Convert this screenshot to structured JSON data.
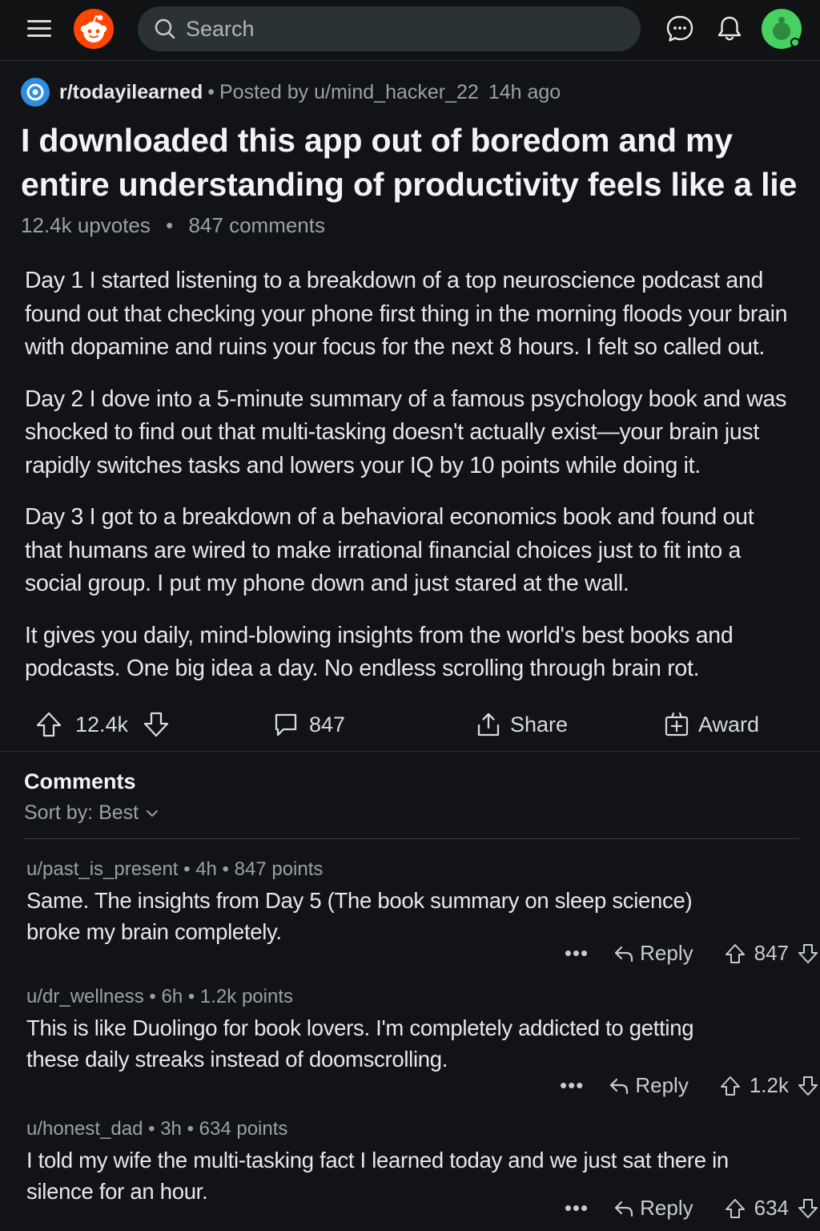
{
  "topbar": {
    "search_placeholder": "Search",
    "icons": [
      "menu-icon",
      "reddit-logo",
      "search-icon",
      "chat-icon",
      "bell-icon",
      "avatar"
    ]
  },
  "post": {
    "subreddit": "r/todayilearned",
    "posted_by": "Posted by u/mind_hacker_22",
    "age": "14h ago",
    "title": "I downloaded this app out of boredom and my entire understanding of productivity feels like a lie",
    "upvotes_label": "12.4k upvotes",
    "comments_label": "847 comments",
    "body": [
      "Day 1 I started listening to a breakdown of a top neuroscience podcast and found out that checking your phone first thing in the morning floods your brain with dopamine and ruins your focus for the next 8 hours. I felt so called out.",
      "Day 2 I dove into a 5-minute summary of a famous psychology book and was shocked to find out that multi-tasking doesn't actually exist—your brain just rapidly switches tasks and lowers your IQ by 10 points while doing it.",
      "Day 3 I got to a breakdown of a behavioral economics book and found out that humans are wired to make irrational financial choices just to fit into a social group. I put my phone down and just stared at the wall.",
      "It gives you daily, mind-blowing insights from the world's best books and podcasts. One big idea a day. No endless scrolling through brain rot."
    ],
    "actions": {
      "score": "12.4k",
      "comments": "847",
      "share": "Share",
      "award": "Award"
    }
  },
  "comments_section": {
    "heading": "Comments",
    "sort_label": "Sort by: Best",
    "items": [
      {
        "meta": "u/past_is_present • 4h • 847 points",
        "text": "Same. The insights from Day 5 (The book summary on sleep science) broke my brain completely.",
        "more": "•••",
        "reply": "Reply",
        "score": "847"
      },
      {
        "meta": "u/dr_wellness • 6h • 1.2k points",
        "text": "This is like Duolingo for book lovers. I'm completely addicted to getting these daily streaks instead of doomscrolling.",
        "more": "•••",
        "reply": "Reply",
        "score": "1.2k"
      },
      {
        "meta": "u/honest_dad • 3h • 634 points",
        "text": "I told my wife the multi-tasking fact I learned today and we just sat there in silence for an hour.",
        "more": "•••",
        "reply": "Reply",
        "score": "634"
      }
    ]
  },
  "colors": {
    "background": "#111316",
    "brand": "#ff4500",
    "search_bg": "#2a3236",
    "avatar": "#46d160",
    "subreddit_icon": "#2d8ee0"
  }
}
